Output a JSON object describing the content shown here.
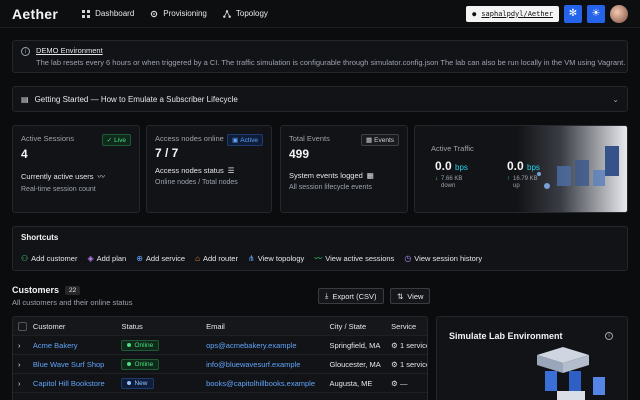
{
  "app": {
    "title": "Aether"
  },
  "nav": [
    {
      "label": "Dashboard"
    },
    {
      "label": "Provisioning"
    },
    {
      "label": "Topology"
    }
  ],
  "topbar": {
    "repo": "saphalpdyl/Aether"
  },
  "banner": {
    "title": "DEMO Environment",
    "body": "The lab resets every 6 hours or when triggered by a CI. The traffic simulation is configurable through simulator.config.json The lab can also be run locally in the VM using Vagrant."
  },
  "accordion": {
    "label": "Getting Started — How to Emulate a Subscriber Lifecycle"
  },
  "cards": {
    "sessions": {
      "label": "Active Sessions",
      "badge": "Live",
      "value": "4",
      "sub": "Currently active users",
      "desc": "Real-time session count"
    },
    "nodes": {
      "label": "Access nodes online",
      "badge": "Active",
      "value": "7 / 7",
      "sub": "Access nodes status",
      "desc": "Online nodes / Total nodes"
    },
    "events": {
      "label": "Total Events",
      "badge": "Events",
      "value": "499",
      "sub": "System events logged",
      "desc": "All session lifecycle events"
    },
    "traffic": {
      "label": "Active Traffic",
      "down": {
        "value": "0.0",
        "unit": "bps",
        "detail1": "7.66 KB",
        "detail2": "down"
      },
      "up": {
        "value": "0.0",
        "unit": "bps",
        "detail1": "16.79 KB",
        "detail2": "up"
      }
    }
  },
  "shortcuts": {
    "title": "Shortcuts",
    "items": [
      {
        "label": "Add customer"
      },
      {
        "label": "Add plan"
      },
      {
        "label": "Add service"
      },
      {
        "label": "Add router"
      },
      {
        "label": "View topology"
      },
      {
        "label": "View active sessions"
      },
      {
        "label": "View session history"
      }
    ]
  },
  "customers": {
    "title": "Customers",
    "count": "22",
    "subtitle": "All customers and their online status",
    "export_label": "Export (CSV)",
    "view_label": "View",
    "headers": [
      "Customer",
      "Status",
      "Email",
      "City / State",
      "Service"
    ],
    "rows": [
      {
        "name": "Acme Bakery",
        "status": "Online",
        "email": "ops@acmebakery.example",
        "city": "Springfield, MA",
        "service": "1 service"
      },
      {
        "name": "Blue Wave Surf Shop",
        "status": "Online",
        "email": "info@bluewavesurf.example",
        "city": "Gloucester, MA",
        "service": "1 service"
      },
      {
        "name": "Capitol Hill Bookstore",
        "status": "New",
        "email": "books@capitolhillbooks.example",
        "city": "Augusta, ME",
        "service": "—"
      }
    ]
  },
  "simulate": {
    "title": "Simulate Lab Environment"
  },
  "colors": {
    "accent": "#2563eb",
    "online": "#4ade80",
    "link": "#60a5fa",
    "traffic": "#22d3ee"
  }
}
